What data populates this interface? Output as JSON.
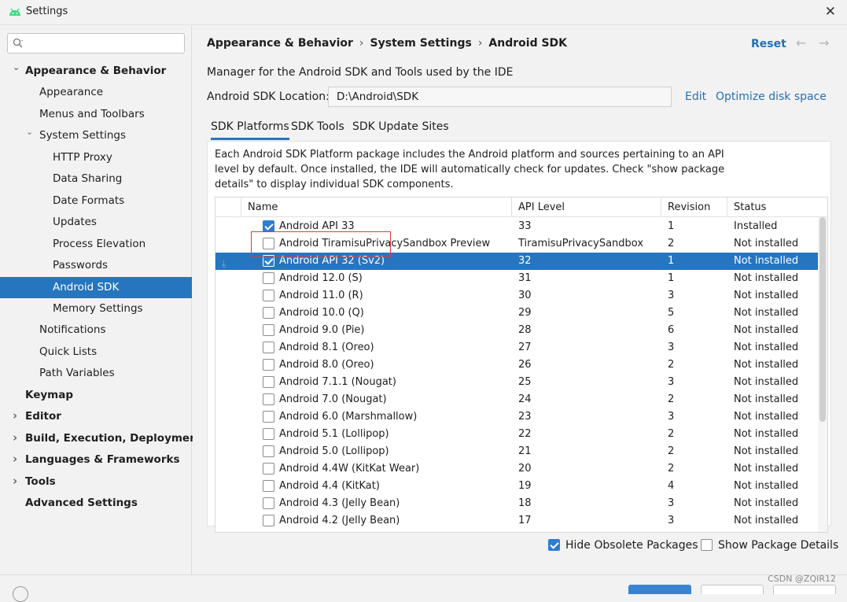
{
  "window": {
    "title": "Settings",
    "close_glyph": "✕"
  },
  "search": {
    "placeholder": "",
    "value": ""
  },
  "sidebar": {
    "items": [
      {
        "label": "Appearance & Behavior",
        "level": 0,
        "bold": true,
        "expanded": true,
        "selected": false
      },
      {
        "label": "Appearance",
        "level": 1,
        "bold": false,
        "selected": false
      },
      {
        "label": "Menus and Toolbars",
        "level": 1,
        "bold": false,
        "selected": false
      },
      {
        "label": "System Settings",
        "level": 1,
        "bold": false,
        "expanded": true,
        "selected": false
      },
      {
        "label": "HTTP Proxy",
        "level": 2,
        "bold": false,
        "selected": false
      },
      {
        "label": "Data Sharing",
        "level": 2,
        "bold": false,
        "selected": false
      },
      {
        "label": "Date Formats",
        "level": 2,
        "bold": false,
        "selected": false
      },
      {
        "label": "Updates",
        "level": 2,
        "bold": false,
        "selected": false
      },
      {
        "label": "Process Elevation",
        "level": 2,
        "bold": false,
        "selected": false
      },
      {
        "label": "Passwords",
        "level": 2,
        "bold": false,
        "selected": false
      },
      {
        "label": "Android SDK",
        "level": 2,
        "bold": false,
        "selected": true
      },
      {
        "label": "Memory Settings",
        "level": 2,
        "bold": false,
        "selected": false
      },
      {
        "label": "Notifications",
        "level": 1,
        "bold": false,
        "selected": false
      },
      {
        "label": "Quick Lists",
        "level": 1,
        "bold": false,
        "selected": false
      },
      {
        "label": "Path Variables",
        "level": 1,
        "bold": false,
        "selected": false
      },
      {
        "label": "Keymap",
        "level": 0,
        "bold": true,
        "selected": false
      },
      {
        "label": "Editor",
        "level": 0,
        "bold": true,
        "collapsed": true,
        "selected": false
      },
      {
        "label": "Build, Execution, Deployment",
        "level": 0,
        "bold": true,
        "collapsed": true,
        "selected": false
      },
      {
        "label": "Languages & Frameworks",
        "level": 0,
        "bold": true,
        "collapsed": true,
        "selected": false
      },
      {
        "label": "Tools",
        "level": 0,
        "bold": true,
        "collapsed": true,
        "selected": false
      },
      {
        "label": "Advanced Settings",
        "level": 0,
        "bold": true,
        "selected": false
      }
    ]
  },
  "breadcrumb": {
    "part1": "Appearance & Behavior",
    "part2": "System Settings",
    "part3": "Android SDK",
    "separator": "›"
  },
  "header": {
    "reset_label": "Reset",
    "back_glyph": "←",
    "forward_glyph": "→"
  },
  "main": {
    "description": "Manager for the Android SDK and Tools used by the IDE",
    "location_label": "Android SDK Location:",
    "location_value": "D:\\Android\\SDK",
    "edit_label": "Edit",
    "optimize_label": "Optimize disk space"
  },
  "tabs": [
    {
      "label": "SDK Platforms",
      "active": true
    },
    {
      "label": "SDK Tools",
      "active": false
    },
    {
      "label": "SDK Update Sites",
      "active": false
    }
  ],
  "info_text": "Each Android SDK Platform package includes the Android platform and sources pertaining to an API level by default. Once installed, the IDE will automatically check for updates. Check \"show package details\" to display individual SDK components.",
  "table": {
    "columns": [
      "Name",
      "API Level",
      "Revision",
      "Status"
    ],
    "rows": [
      {
        "checked": true,
        "name": "Android API 33",
        "api": "33",
        "revision": "1",
        "status": "Installed",
        "selected": false,
        "download": false
      },
      {
        "checked": false,
        "name": "Android TiramisuPrivacySandbox Preview",
        "api": "TiramisuPrivacySandbox",
        "revision": "2",
        "status": "Not installed",
        "selected": false,
        "download": false
      },
      {
        "checked": true,
        "name": "Android API 32 (Sv2)",
        "api": "32",
        "revision": "1",
        "status": "Not installed",
        "selected": true,
        "download": true
      },
      {
        "checked": false,
        "name": "Android 12.0 (S)",
        "api": "31",
        "revision": "1",
        "status": "Not installed",
        "selected": false,
        "download": false
      },
      {
        "checked": false,
        "name": "Android 11.0 (R)",
        "api": "30",
        "revision": "3",
        "status": "Not installed",
        "selected": false,
        "download": false
      },
      {
        "checked": false,
        "name": "Android 10.0 (Q)",
        "api": "29",
        "revision": "5",
        "status": "Not installed",
        "selected": false,
        "download": false
      },
      {
        "checked": false,
        "name": "Android 9.0 (Pie)",
        "api": "28",
        "revision": "6",
        "status": "Not installed",
        "selected": false,
        "download": false
      },
      {
        "checked": false,
        "name": "Android 8.1 (Oreo)",
        "api": "27",
        "revision": "3",
        "status": "Not installed",
        "selected": false,
        "download": false
      },
      {
        "checked": false,
        "name": "Android 8.0 (Oreo)",
        "api": "26",
        "revision": "2",
        "status": "Not installed",
        "selected": false,
        "download": false
      },
      {
        "checked": false,
        "name": "Android 7.1.1 (Nougat)",
        "api": "25",
        "revision": "3",
        "status": "Not installed",
        "selected": false,
        "download": false
      },
      {
        "checked": false,
        "name": "Android 7.0 (Nougat)",
        "api": "24",
        "revision": "2",
        "status": "Not installed",
        "selected": false,
        "download": false
      },
      {
        "checked": false,
        "name": "Android 6.0 (Marshmallow)",
        "api": "23",
        "revision": "3",
        "status": "Not installed",
        "selected": false,
        "download": false
      },
      {
        "checked": false,
        "name": "Android 5.1 (Lollipop)",
        "api": "22",
        "revision": "2",
        "status": "Not installed",
        "selected": false,
        "download": false
      },
      {
        "checked": false,
        "name": "Android 5.0 (Lollipop)",
        "api": "21",
        "revision": "2",
        "status": "Not installed",
        "selected": false,
        "download": false
      },
      {
        "checked": false,
        "name": "Android 4.4W (KitKat Wear)",
        "api": "20",
        "revision": "2",
        "status": "Not installed",
        "selected": false,
        "download": false
      },
      {
        "checked": false,
        "name": "Android 4.4 (KitKat)",
        "api": "19",
        "revision": "4",
        "status": "Not installed",
        "selected": false,
        "download": false
      },
      {
        "checked": false,
        "name": "Android 4.3 (Jelly Bean)",
        "api": "18",
        "revision": "3",
        "status": "Not installed",
        "selected": false,
        "download": false
      },
      {
        "checked": false,
        "name": "Android 4.2 (Jelly Bean)",
        "api": "17",
        "revision": "3",
        "status": "Not installed",
        "selected": false,
        "download": false
      }
    ]
  },
  "options": {
    "hide_obsolete_label": "Hide Obsolete Packages",
    "hide_obsolete_checked": true,
    "show_details_label": "Show Package Details",
    "show_details_checked": false
  },
  "watermark": "CSDN @ZQIR12",
  "colors": {
    "accent": "#2675bf",
    "link": "#2470b3",
    "highlight": "#e03a3a"
  }
}
